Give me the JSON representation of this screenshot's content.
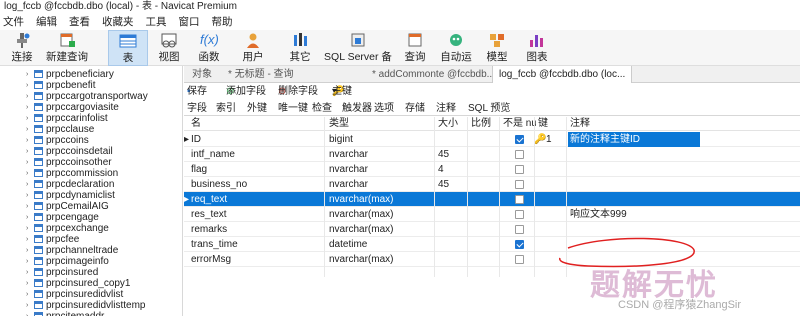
{
  "window": {
    "title": "log_fccb @fccbdb.dbo (local) - 表 - Navicat Premium"
  },
  "menu": [
    "文件",
    "编辑",
    "查看",
    "收藏夹",
    "工具",
    "窗口",
    "帮助"
  ],
  "toolbar": [
    {
      "label": "连接",
      "icon": "plug-icon"
    },
    {
      "label": "新建查询",
      "icon": "new-query-icon"
    },
    {
      "label": "表",
      "icon": "table-icon"
    },
    {
      "label": "视图",
      "icon": "view-icon"
    },
    {
      "label": "函数",
      "icon": "function-icon"
    },
    {
      "label": "用户",
      "icon": "user-icon"
    },
    {
      "label": "其它",
      "icon": "tools-icon"
    },
    {
      "label": "SQL Server 备份",
      "icon": "backup-icon"
    },
    {
      "label": "查询",
      "icon": "query-icon"
    },
    {
      "label": "自动运行",
      "icon": "robot-icon"
    },
    {
      "label": "模型",
      "icon": "model-icon"
    },
    {
      "label": "图表",
      "icon": "chart-icon"
    }
  ],
  "sidebar": {
    "items": [
      "prpcbeneficiary",
      "prpcbenefit",
      "prpccargotransportway",
      "prpccargoviasite",
      "prpccarinfolist",
      "prpcclause",
      "prpccoins",
      "prpccoinsdetail",
      "prpccoinsother",
      "prpccommission",
      "prpcdeclaration",
      "prpcdynamiclist",
      "prpCemailAIG",
      "prpcengage",
      "prpcexchange",
      "prpcfee",
      "prpchanneltrade",
      "prpcimageinfo",
      "prpcinsured",
      "prpcinsured_copy1",
      "prpcinsuredidvlist",
      "prpcinsuredidvlisttemp",
      "prpcitemaddr"
    ]
  },
  "tabs": [
    "对象",
    "* 无标题 - 查询",
    "* addCommonte @fccbdb...",
    "log_fccb @fccbdb.dbo (loc..."
  ],
  "actions": {
    "save": "保存",
    "add_field": "添加字段",
    "delete_field": "删除字段",
    "primary_key": "主键"
  },
  "subtabs": [
    "字段",
    "索引",
    "外键",
    "唯一键",
    "检查",
    "触发器",
    "选项",
    "存储",
    "注释",
    "SQL 预览"
  ],
  "columns": {
    "name": "名",
    "type": "类型",
    "size": "大小",
    "scale": "比例",
    "notnull": "不是 null",
    "key": "键",
    "comment": "注释"
  },
  "rows": [
    {
      "name": "ID",
      "type": "bigint",
      "size": "",
      "notnull": true,
      "key": "1",
      "comment": "新的注释主键ID",
      "marker": "▸"
    },
    {
      "name": "intf_name",
      "type": "nvarchar",
      "size": "45",
      "notnull": false,
      "key": "",
      "comment": "",
      "marker": ""
    },
    {
      "name": "flag",
      "type": "nvarchar",
      "size": "4",
      "notnull": false,
      "key": "",
      "comment": "",
      "marker": ""
    },
    {
      "name": "business_no",
      "type": "nvarchar",
      "size": "45",
      "notnull": false,
      "key": "",
      "comment": "",
      "marker": ""
    },
    {
      "name": "req_text",
      "type": "nvarchar(max)",
      "size": "",
      "notnull": false,
      "key": "",
      "comment": "",
      "marker": "▸"
    },
    {
      "name": "res_text",
      "type": "nvarchar(max)",
      "size": "",
      "notnull": false,
      "key": "",
      "comment": "响应文本999",
      "marker": ""
    },
    {
      "name": "remarks",
      "type": "nvarchar(max)",
      "size": "",
      "notnull": false,
      "key": "",
      "comment": "",
      "marker": ""
    },
    {
      "name": "trans_time",
      "type": "datetime",
      "size": "",
      "notnull": true,
      "key": "",
      "comment": "",
      "marker": ""
    },
    {
      "name": "errorMsg",
      "type": "nvarchar(max)",
      "size": "",
      "notnull": false,
      "key": "",
      "comment": "",
      "marker": ""
    }
  ],
  "watermark": {
    "text": "题解无忧",
    "csdn": "CSDN @程序猿ZhangSir"
  }
}
